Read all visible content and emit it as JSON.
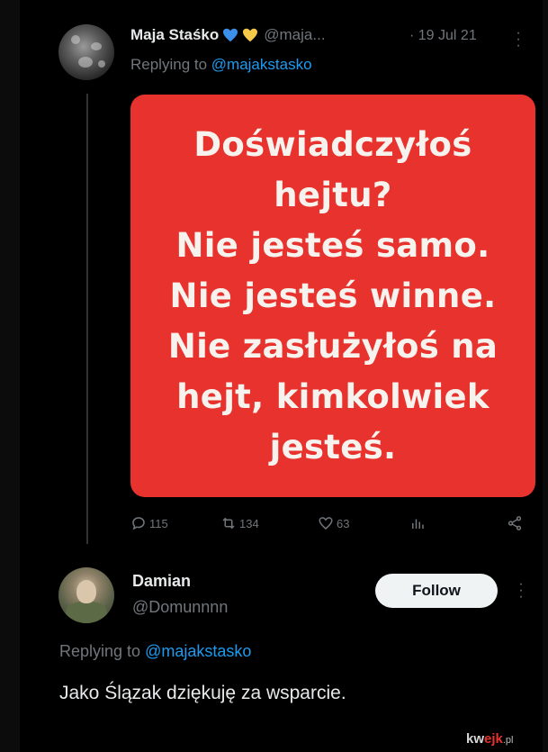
{
  "tweet1": {
    "name": "Maja Staśko",
    "handle": "@maja...",
    "date": "· 19 Jul 21",
    "replying_prefix": "Replying to ",
    "replying_mention": "@majakstasko",
    "image_text_lines": [
      "Doświadczyłoś",
      "hejtu?",
      "Nie jesteś samo.",
      "Nie jesteś winne.",
      "Nie zasłużyłoś na",
      "hejt, kimkolwiek",
      "jesteś."
    ],
    "card_color": "#e8322d",
    "emoji": [
      "blue-heart",
      "yellow-heart"
    ],
    "actions": {
      "replies": "115",
      "retweets": "134",
      "likes": "63"
    }
  },
  "tweet2": {
    "name": "Damian",
    "handle": "@Domunnnn",
    "follow_label": "Follow",
    "replying_prefix": "Replying to ",
    "replying_mention": "@majakstasko",
    "text": "Jako Ślązak dziękuję za wsparcie."
  },
  "watermark": {
    "part1": "kw",
    "part2": "ejk",
    "part3": ".pl"
  },
  "colors": {
    "background": "#000000",
    "text": "#e7e9ea",
    "muted": "#71767b",
    "link": "#1d9bf0"
  }
}
